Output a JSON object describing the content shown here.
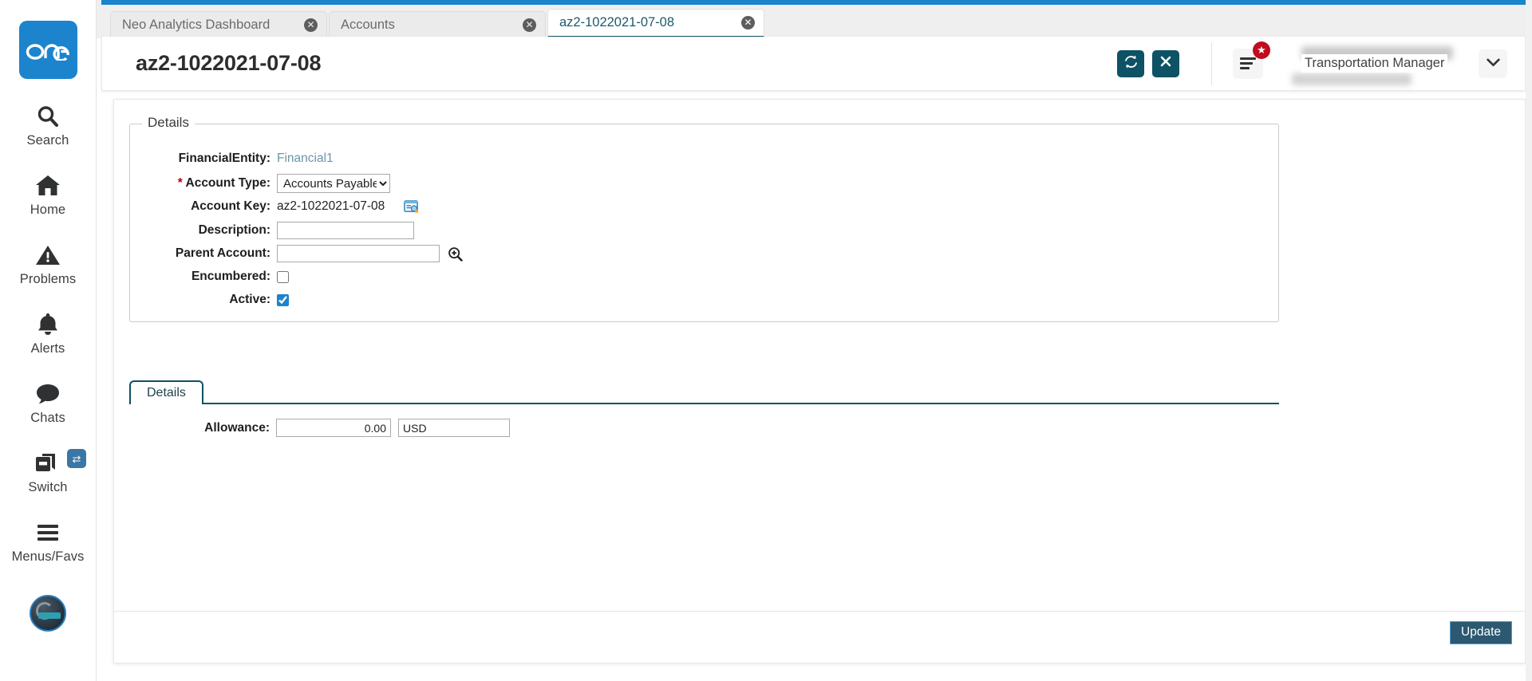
{
  "sidebar": {
    "logo_text": "one",
    "items": [
      {
        "label": "Search",
        "icon": "search-icon"
      },
      {
        "label": "Home",
        "icon": "home-icon"
      },
      {
        "label": "Problems",
        "icon": "warning-triangle-icon"
      },
      {
        "label": "Alerts",
        "icon": "bell-icon"
      },
      {
        "label": "Chats",
        "icon": "chat-bubble-icon"
      },
      {
        "label": "Switch",
        "icon": "switch-windows-icon",
        "badge_icon": "swap-arrows-icon"
      },
      {
        "label": "Menus/Favs",
        "icon": "hamburger-icon"
      }
    ],
    "avatar_icon": "robot-avatar-icon"
  },
  "tabs": [
    {
      "label": "Neo Analytics Dashboard",
      "active": false,
      "close_icon": "close-circle-icon"
    },
    {
      "label": "Accounts",
      "active": false,
      "close_icon": "close-circle-icon"
    },
    {
      "label": "az2-1022021-07-08",
      "active": true,
      "close_icon": "close-circle-icon"
    }
  ],
  "header": {
    "title": "az2-1022021-07-08",
    "refresh_icon": "refresh-icon",
    "close_icon": "x-icon",
    "menu_icon": "hamburger-icon",
    "menu_badge_icon": "star-badge-icon",
    "user_role": "Transportation Manager",
    "caret_icon": "chevron-down-icon"
  },
  "details": {
    "legend": "Details",
    "fields": {
      "financial_entity_label": "FinancialEntity:",
      "financial_entity_value": "Financial1",
      "account_type_label": "Account Type:",
      "account_type_required": "*",
      "account_type_value": "Accounts Payable",
      "account_type_options": [
        "Accounts Payable"
      ],
      "account_key_label": "Account Key:",
      "account_key_value": "az2-1022021-07-08",
      "account_key_icon": "lookup-window-icon",
      "description_label": "Description:",
      "description_value": "",
      "parent_account_label": "Parent Account:",
      "parent_account_value": "",
      "parent_account_icon": "magnifier-plus-icon",
      "encumbered_label": "Encumbered:",
      "encumbered_checked": false,
      "active_label": "Active:",
      "active_checked": true
    }
  },
  "subtabs": [
    {
      "label": "Details",
      "active": true
    }
  ],
  "allowance": {
    "label": "Allowance:",
    "amount": "0.00",
    "currency": "USD"
  },
  "footer": {
    "update_label": "Update"
  },
  "colors": {
    "brand_blue": "#1b84cd",
    "teal": "#0d5265",
    "badge_red": "#c00c1e",
    "update_button": "#2c5871"
  }
}
